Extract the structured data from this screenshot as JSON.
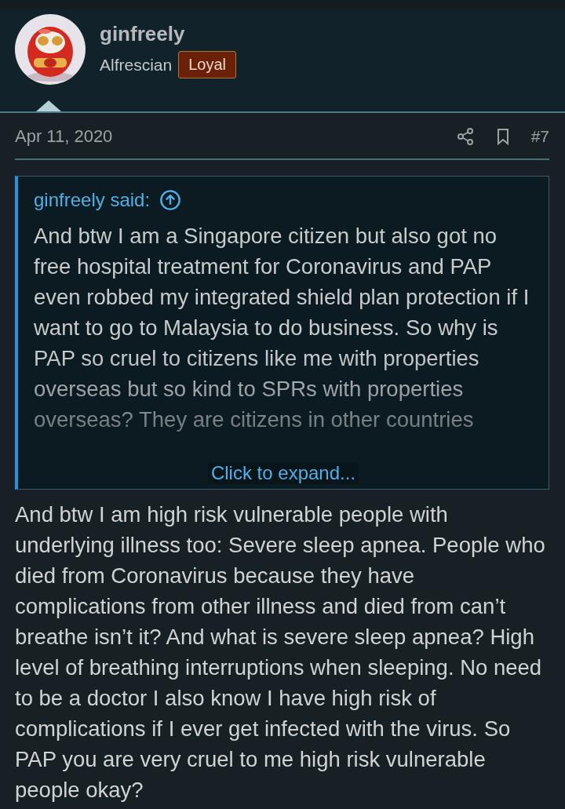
{
  "author": {
    "name": "ginfreely",
    "title": "Alfrescian",
    "badge": "Loyal"
  },
  "post": {
    "date": "Apr 11, 2020",
    "number": "#7"
  },
  "quote": {
    "attribution": "ginfreely said:",
    "text": "And btw I am a Singapore citizen but also got no free hospital treatment for Coronavirus and PAP even robbed my integrated shield plan protection if I want to go to Malaysia to do business. So why is PAP so cruel to citizens like me with properties overseas but so kind to SPRs with properties overseas? They are citizens in other countries",
    "expand": "Click to expand...",
    "expanded": false
  },
  "body": "And btw I am high risk vulnerable people with underlying illness too: Severe sleep apnea. People who died from Coronavirus because they have complications from other illness and died from can’t breathe isn’t it? And what is severe sleep apnea? High level of breathing interruptions when sleeping. No need to be a doctor I also know I have high risk of complications if I ever get infected with the virus. So PAP you are very cruel to me high risk vulnerable people okay?"
}
